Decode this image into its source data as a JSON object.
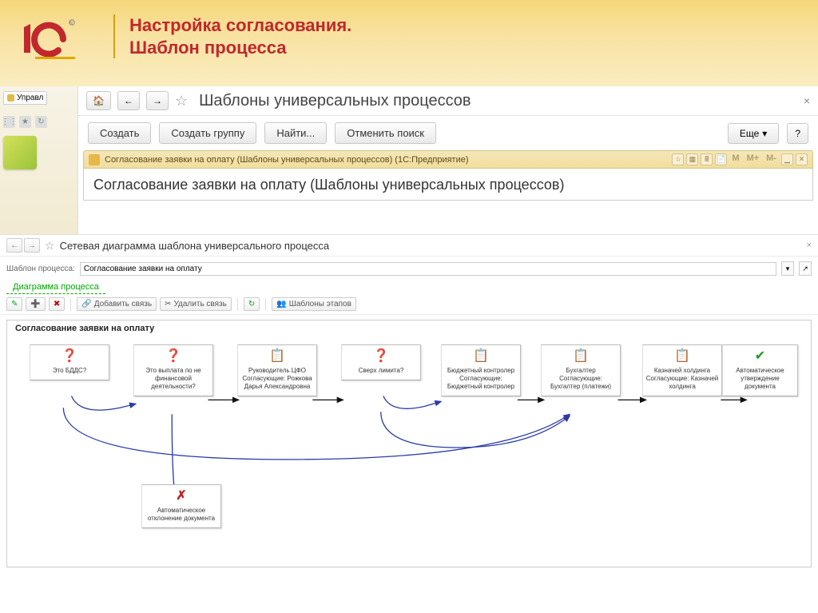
{
  "slide": {
    "title_line1": "Настройка согласования.",
    "title_line2": "Шаблон процесса"
  },
  "left_stub": {
    "tab": "Управл"
  },
  "main": {
    "title": "Шаблоны универсальных процессов"
  },
  "toolbar": {
    "create": "Создать",
    "create_group": "Создать группу",
    "find": "Найти...",
    "cancel_find": "Отменить поиск",
    "more": "Еще",
    "help": "?"
  },
  "modal": {
    "window_title": "Согласование заявки на оплату (Шаблоны универсальных процессов) (1С:Предприятие)",
    "big_title": "Согласование заявки на оплату (Шаблоны универсальных процессов)",
    "m_labels": [
      "M",
      "M+",
      "M-"
    ]
  },
  "diagram": {
    "page_title": "Сетевая диаграмма шаблона универсального процесса",
    "template_label": "Шаблон процесса:",
    "template_value": "Согласование заявки на оплату",
    "section_label": "Диаграмма процесса",
    "tb": {
      "add_link": "Добавить связь",
      "del_link": "Удалить связь",
      "stage_templates": "Шаблоны этапов"
    },
    "canvas_title": "Согласование заявки на оплату",
    "nodes": [
      {
        "id": "n1",
        "icon": "q",
        "text": "Это БДДС?"
      },
      {
        "id": "n2",
        "icon": "q",
        "text": "Это выплата по не финансовой деятельности?"
      },
      {
        "id": "n3",
        "icon": "task",
        "text": "Руководитель ЦФО Согласующие: Рожкова Дарья Александровна"
      },
      {
        "id": "n4",
        "icon": "q",
        "text": "Сверх лимита?"
      },
      {
        "id": "n5",
        "icon": "task",
        "text": "Бюджетный контролер Согласующие: Бюджетный контролер"
      },
      {
        "id": "n6",
        "icon": "task",
        "text": "Бухгалтер Согласующие: Бухгалтер (платежи)"
      },
      {
        "id": "n7",
        "icon": "task",
        "text": "Казначей холдинга Согласующие: Казначей холдинга"
      },
      {
        "id": "n8",
        "icon": "check",
        "text": "Автоматическое утверждение документа"
      },
      {
        "id": "n9",
        "icon": "reject",
        "text": "Автоматическое отклонение документа"
      }
    ]
  }
}
